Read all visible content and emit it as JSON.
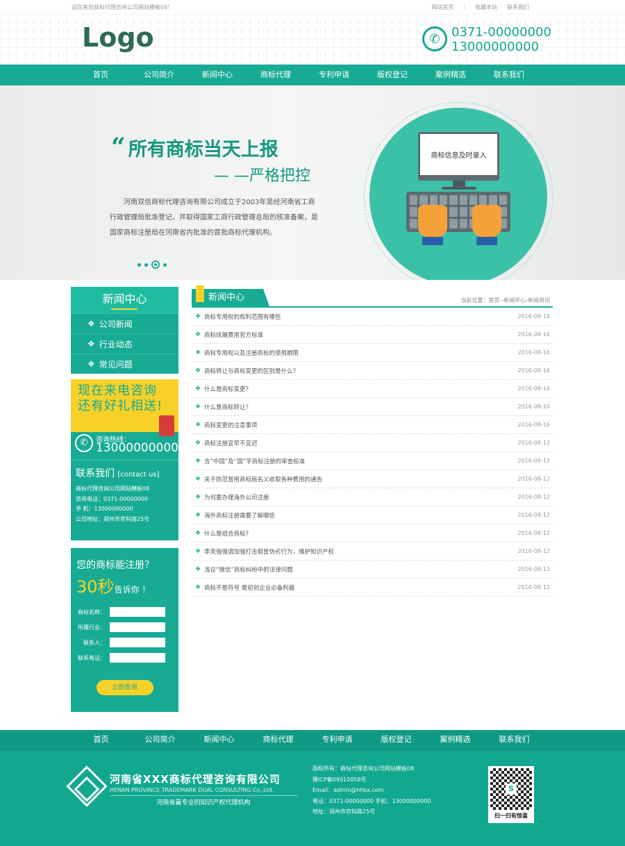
{
  "topbar": {
    "welcome": "迎您来到商标代理咨询公司网站模板08！",
    "links": [
      "网站首页",
      "|",
      "收藏本站",
      "联系我们"
    ]
  },
  "header": {
    "logo": "Logo",
    "phone1": "0371-00000000",
    "phone2": "13000000000"
  },
  "nav": [
    "首页",
    "公司简介",
    "新闻中心",
    "商标代理",
    "专利申请",
    "版权登记",
    "案例精选",
    "联系我们"
  ],
  "banner": {
    "headline": "所有商标当天上报",
    "subline": "— —严格把控",
    "desc": "河南双信商标代理咨询有限公司成立于2003年是经河南省工商行政管理局批准登记，并取得国家工商行政管理总局的核准备案，是国家商标注册局在河南省内批准的首批商标代理机构。",
    "screen": "商标信息及时录入"
  },
  "sidebar": {
    "title": "新闻中心",
    "items": [
      "公司新闻",
      "行业动态",
      "常见问题"
    ],
    "promo": {
      "line1": "现在来电咨询",
      "line2": "还有好礼相送!",
      "tel_label": "咨询热线：",
      "tel": "13000000000"
    },
    "contact": {
      "title": "联系我们",
      "title_en": "[contact us]",
      "lines": [
        "商标代理咨询公司网站模板08",
        "咨询电话：0371-00000000",
        "手  机：13000000000",
        "公司地址：郑州市农科路25号"
      ]
    },
    "query": {
      "q1": "您的商标能注册？",
      "num": "30秒",
      "q2": "告诉你 ！",
      "fields": [
        "商标名称：",
        "所属行业：",
        "联系人：",
        "联系电话："
      ],
      "button": "立即查询"
    }
  },
  "content": {
    "title": "新闻中心",
    "breadcrumb": "当前位置：首页--新闻中心-新闻资讯",
    "news": [
      {
        "t": "商标专用权的权利范围有哪些",
        "d": "2016-08-16"
      },
      {
        "t": "商标续展费用官方标准",
        "d": "2016-08-16"
      },
      {
        "t": "商标专用权以及注册商标的使用期限",
        "d": "2016-08-16"
      },
      {
        "t": "商标转让与商标变更的区别是什么？",
        "d": "2016-08-16"
      },
      {
        "t": "什么是商标变更？",
        "d": "2016-08-16"
      },
      {
        "t": "什么是商标转让？",
        "d": "2016-08-16"
      },
      {
        "t": "商标变更的注意事项",
        "d": "2016-08-16"
      },
      {
        "t": "商标注册宜早不宜迟",
        "d": "2016-08-12"
      },
      {
        "t": "含“中国”及“国”字商标注册的审查标准",
        "d": "2016-08-12"
      },
      {
        "t": "关于防范冒用商标局名义收取各种费用的通告",
        "d": "2016-08-12"
      },
      {
        "t": "为何要办理海外公司注册",
        "d": "2016-08-12"
      },
      {
        "t": "海外商标注册需要了解哪些",
        "d": "2016-08-12"
      },
      {
        "t": "什么是组合商标？",
        "d": "2016-08-12"
      },
      {
        "t": "李克强强调加强打击假冒伪劣行为，维护知识产权",
        "d": "2016-08-12"
      },
      {
        "t": "浅议“微信”商标纠纷中的法律问题",
        "d": "2016-08-12"
      },
      {
        "t": "商标不是符号 是初创企业必备利器",
        "d": "2016-08-12"
      }
    ]
  },
  "footer": {
    "nav": [
      "首页",
      "公司简介",
      "新闻中心",
      "商标代理",
      "专利申请",
      "版权登记",
      "案例精选",
      "联系我们"
    ],
    "company": "河南省XXX商标代理咨询有限公司",
    "company_en": "HENAN PROVINCE TRADEMARK DUAL CONSULTING Co.,Ltd.",
    "slogan": "河南省最专业的知识产权代理机构",
    "info": [
      "版权所有：商标代理咨询公司网站模板08",
      "豫ICP备09010058号",
      "Email：admin@hhkx.com",
      "电话：0371-00000000  手机：13000000000",
      "地址：郑州市农科路25号"
    ],
    "qr_text": "扫一扫有惊喜"
  },
  "colors": {
    "accent": "#17ab94",
    "yellow": "#f7d128"
  }
}
